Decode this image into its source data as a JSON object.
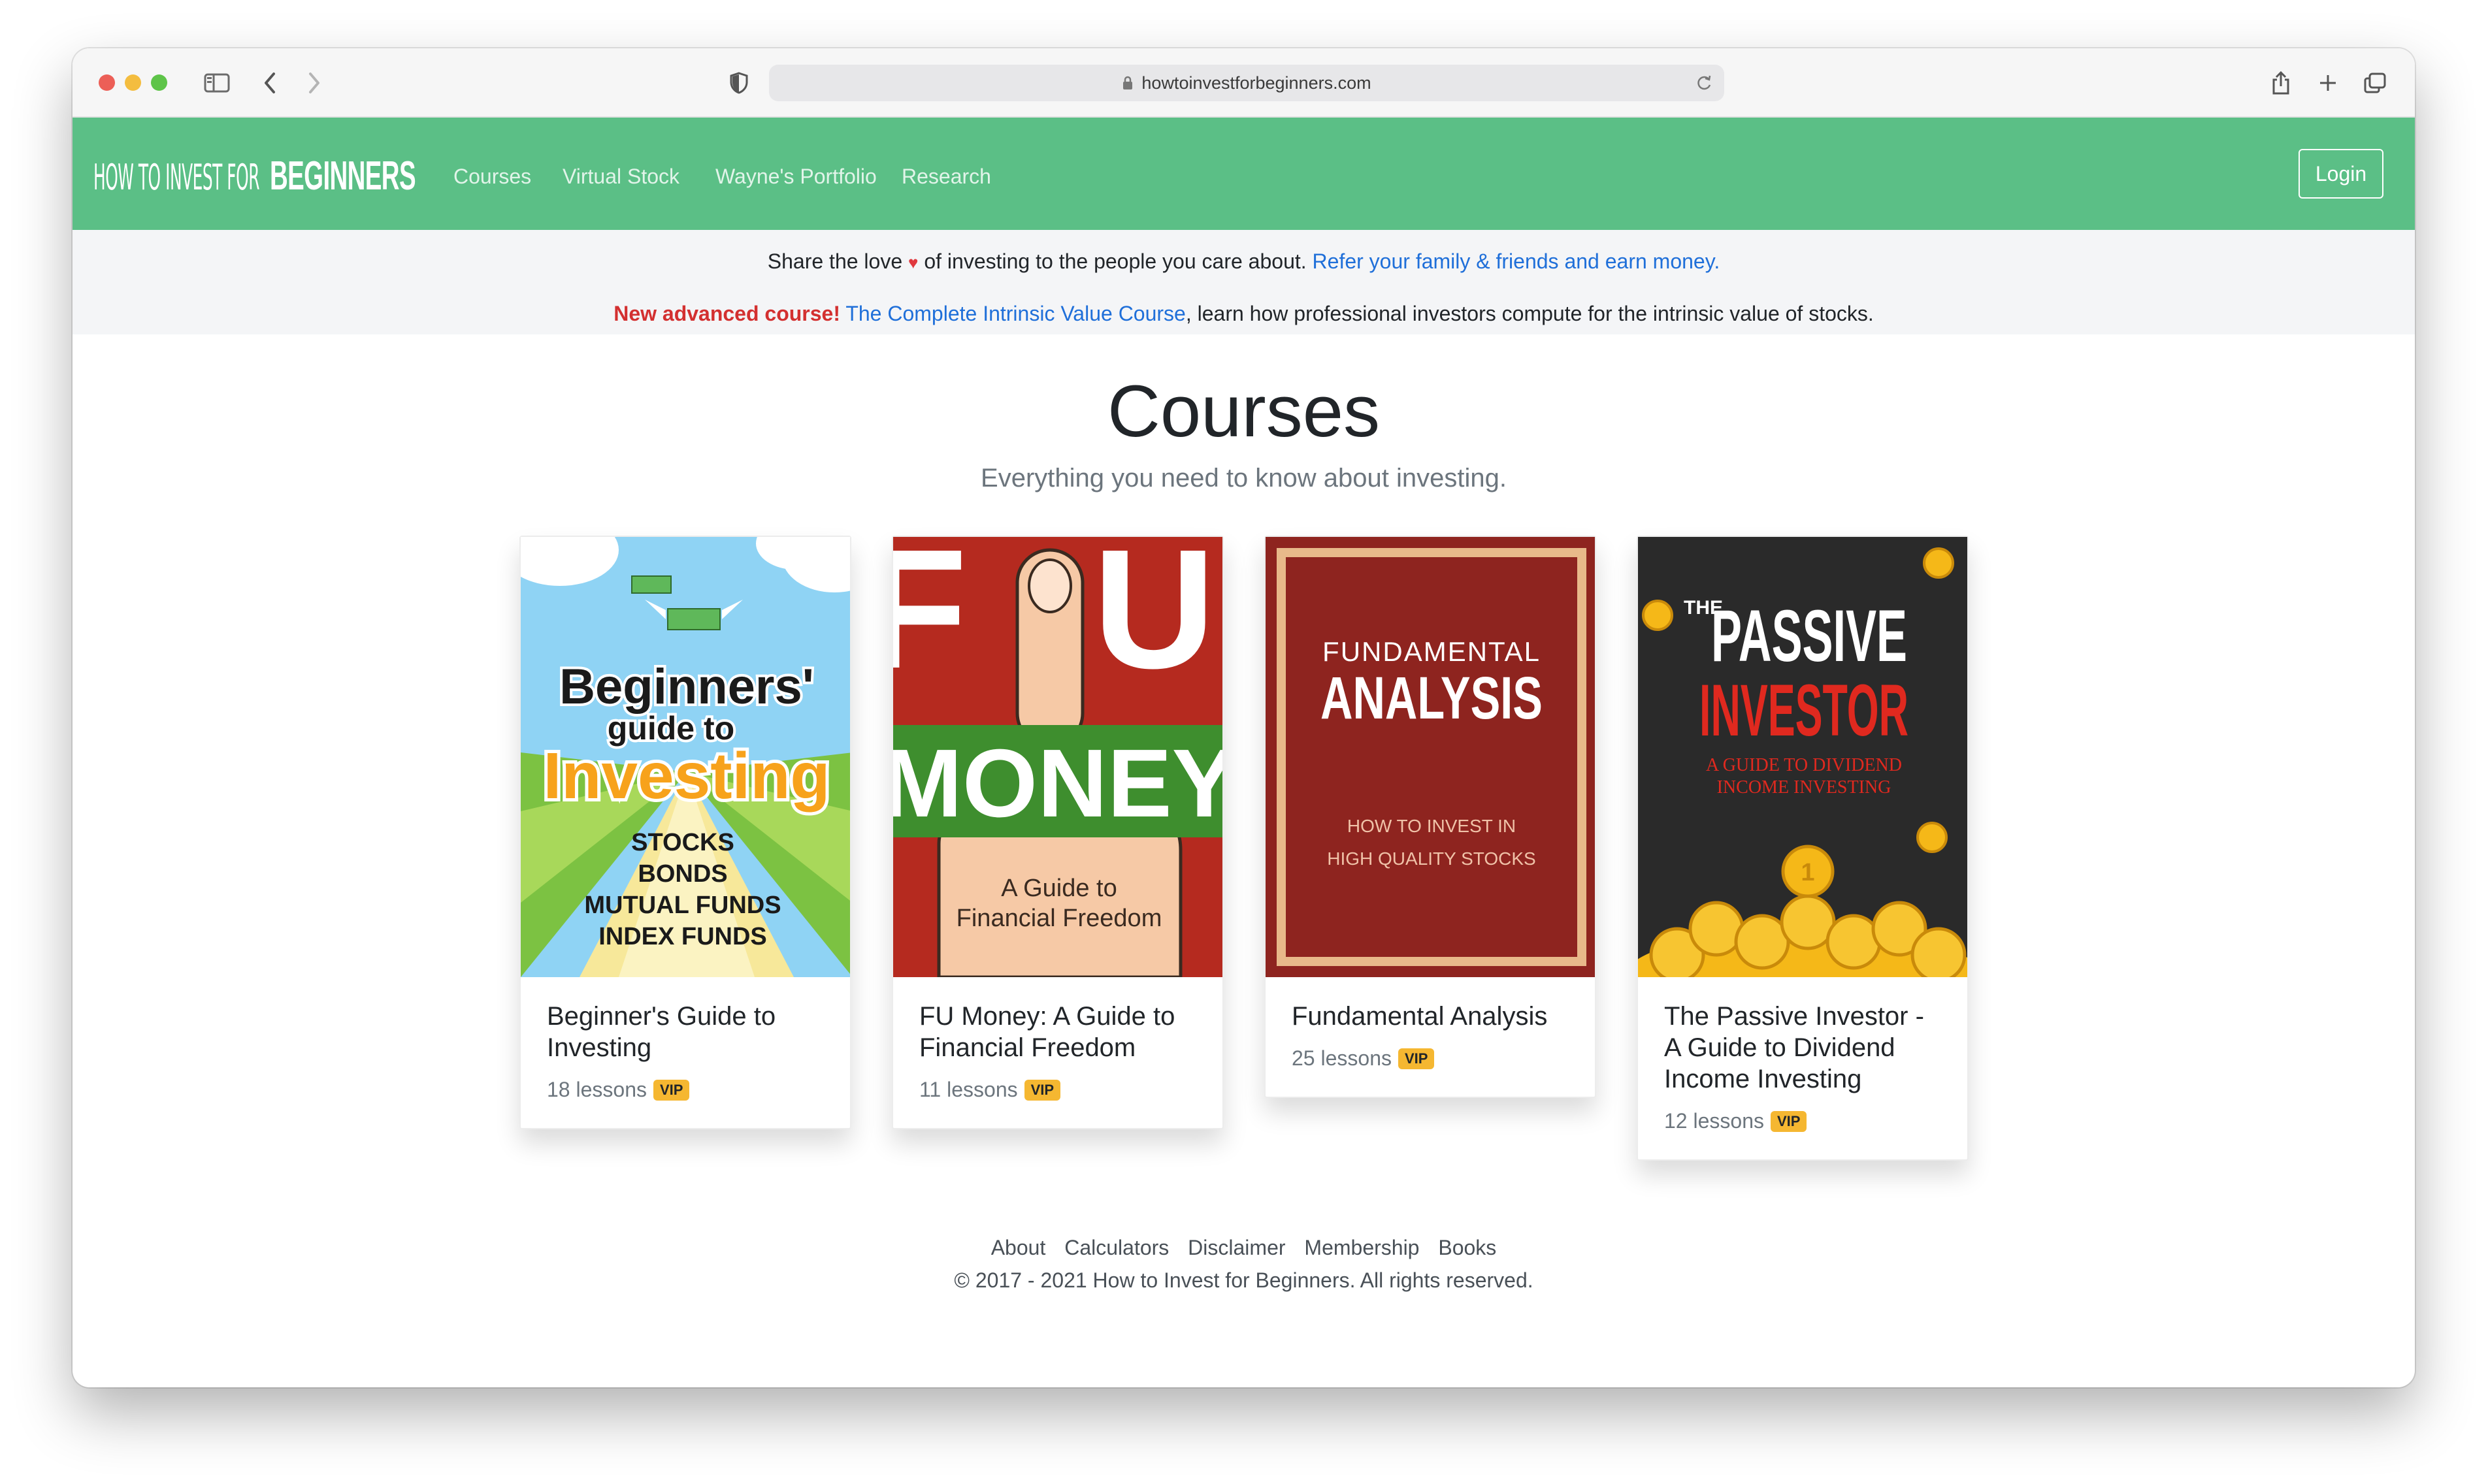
{
  "browser": {
    "url": "howtoinvestforbeginners.com"
  },
  "navbar": {
    "brand_thin": "HOW TO INVEST FOR",
    "brand_bold": "BEGINNERS",
    "links": [
      "Courses",
      "Virtual Stock",
      "Wayne's Portfolio",
      "Research"
    ],
    "login_label": "Login"
  },
  "announcements": {
    "share_before": "Share the love",
    "share_heart": "♥",
    "share_after": "of investing to the people you care about.",
    "share_link": "Refer your family & friends and earn money.",
    "new_label": "New advanced course!",
    "new_link": "The Complete Intrinsic Value Course",
    "new_after": ", learn how professional investors compute for the intrinsic value of stocks."
  },
  "main": {
    "title": "Courses",
    "subtitle": "Everything you need to know about investing."
  },
  "courses": [
    {
      "title": "Beginner's Guide to Investing",
      "lessons": "18 lessons",
      "badge": "VIP",
      "cover": {
        "line1": "Beginners'",
        "line2": "guide to",
        "line3": "Investing",
        "items": [
          "STOCKS",
          "BONDS",
          "MUTUAL FUNDS",
          "INDEX FUNDS"
        ],
        "colors": {
          "sky": "#8fd3f4",
          "grass": "#7cc242",
          "road": "#f7e89a",
          "title_orange": "#f7a21b"
        }
      }
    },
    {
      "title": "FU Money: A Guide to Financial Freedom",
      "lessons": "11 lessons",
      "badge": "VIP",
      "cover": {
        "big": "F U",
        "band": "MONEY",
        "sub1": "A Guide to",
        "sub2": "Financial Freedom",
        "colors": {
          "bg": "#b52a1f",
          "band": "#3e8e2e",
          "hand": "#f6c9a6"
        }
      }
    },
    {
      "title": "Fundamental Analysis",
      "lessons": "25 lessons",
      "badge": "VIP",
      "cover": {
        "line1": "FUNDAMENTAL",
        "line2": "ANALYSIS",
        "sub1": "HOW TO INVEST IN",
        "sub2": "HIGH QUALITY STOCKS",
        "colors": {
          "bg": "#8e241f",
          "frame": "#e8b98a"
        }
      }
    },
    {
      "title": "The Passive Investor - A Guide to Dividend Income Investing",
      "lessons": "12 lessons",
      "badge": "VIP",
      "cover": {
        "the": "THE",
        "line1": "PASSIVE",
        "line2": "INVESTOR",
        "sub1": "A GUIDE TO DIVIDEND",
        "sub2": "INCOME INVESTING",
        "coin_label": "1",
        "colors": {
          "bg": "#2a2a2a",
          "red": "#e0291f",
          "coin": "#f5b818"
        }
      }
    }
  ],
  "footer": {
    "links": [
      "About",
      "Calculators",
      "Disclaimer",
      "Membership",
      "Books"
    ],
    "copyright": "© 2017 - 2021 How to Invest for Beginners. All rights reserved."
  }
}
